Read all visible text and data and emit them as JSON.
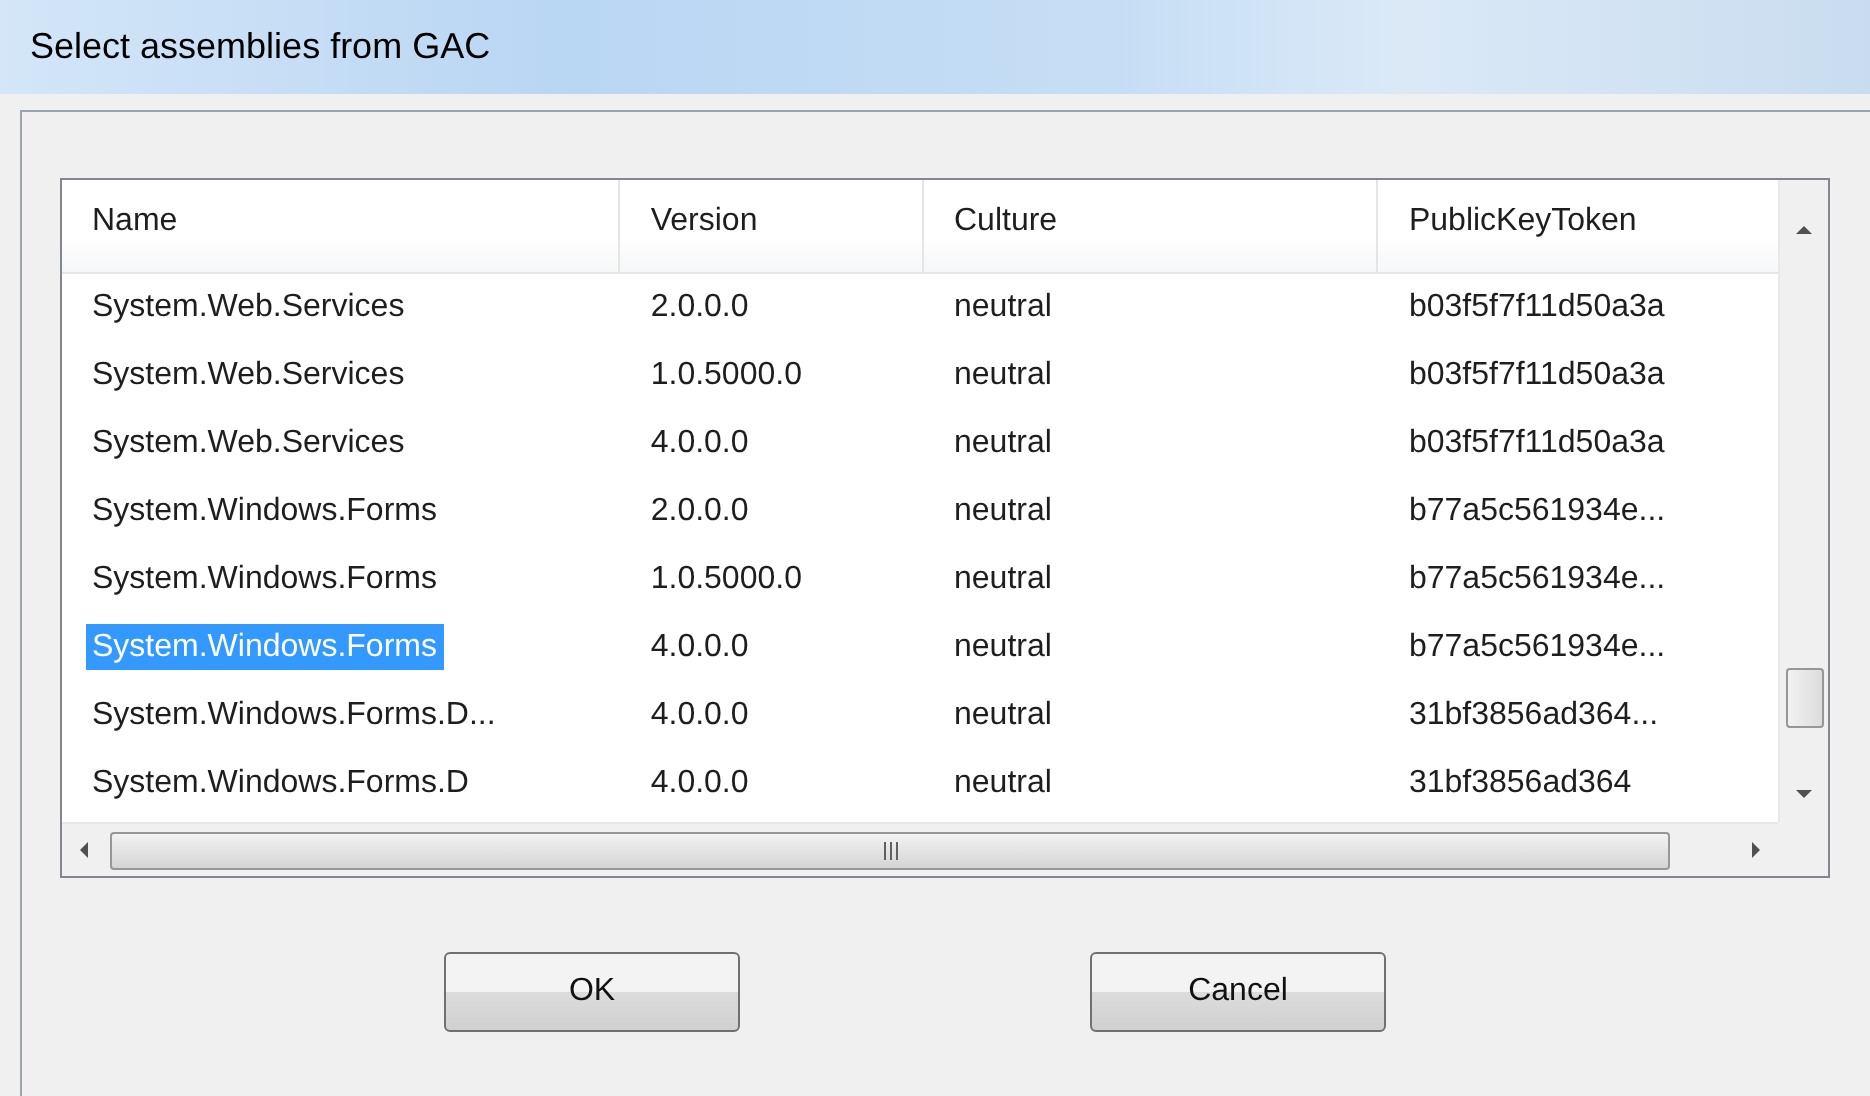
{
  "window": {
    "title": "Select assemblies from GAC"
  },
  "list": {
    "columns": [
      "Name",
      "Version",
      "Culture",
      "PublicKeyToken"
    ],
    "rows": [
      {
        "cells": [
          "System.Web.Services",
          "2.0.0.0",
          "neutral",
          "b03f5f7f11d50a3a"
        ],
        "selected": false
      },
      {
        "cells": [
          "System.Web.Services",
          "1.0.5000.0",
          "neutral",
          "b03f5f7f11d50a3a"
        ],
        "selected": false
      },
      {
        "cells": [
          "System.Web.Services",
          "4.0.0.0",
          "neutral",
          "b03f5f7f11d50a3a"
        ],
        "selected": false
      },
      {
        "cells": [
          "System.Windows.Forms",
          "2.0.0.0",
          "neutral",
          "b77a5c561934e..."
        ],
        "selected": false
      },
      {
        "cells": [
          "System.Windows.Forms",
          "1.0.5000.0",
          "neutral",
          "b77a5c561934e..."
        ],
        "selected": false
      },
      {
        "cells": [
          "System.Windows.Forms",
          "4.0.0.0",
          "neutral",
          "b77a5c561934e..."
        ],
        "selected": true
      },
      {
        "cells": [
          "System.Windows.Forms.D...",
          "4.0.0.0",
          "neutral",
          "31bf3856ad364..."
        ],
        "selected": false
      },
      {
        "cells": [
          "System.Windows.Forms.D",
          "4.0.0.0",
          "neutral",
          "31bf3856ad364"
        ],
        "selected": false
      }
    ]
  },
  "buttons": [
    "OK",
    "Cancel"
  ]
}
